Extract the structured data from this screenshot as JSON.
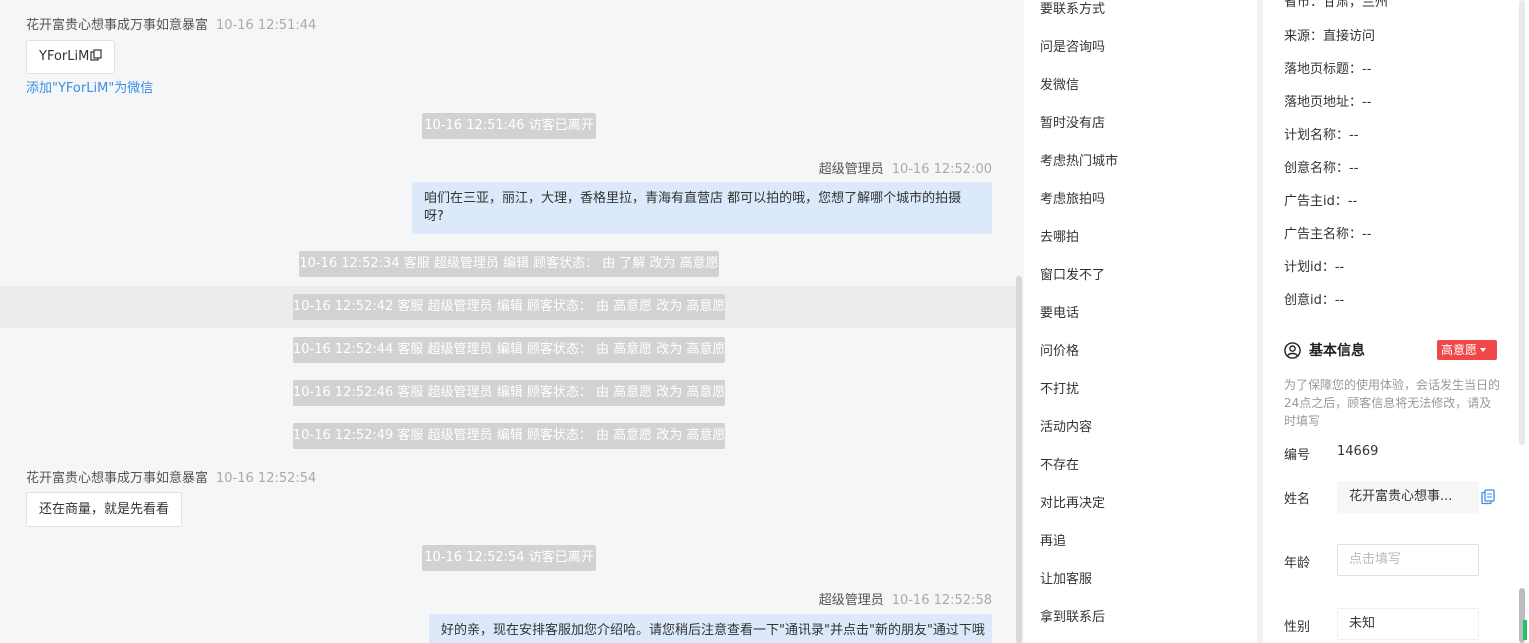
{
  "chat": {
    "messages": [
      {
        "sender": "花开富贵心想事成万事如意暴富",
        "time": "10-16 12:51:44",
        "bubble": "YForLiM",
        "add_wechat_link": "添加\"YForLiM\"为微信"
      },
      {
        "system": "10-16 12:51:46 访客已离开"
      },
      {
        "sender": "超级管理员",
        "time": "10-16 12:52:00",
        "text": "咱们在三亚，丽江，大理，香格里拉，青海有直营店 都可以拍的哦，您想了解哪个城市的拍摄呀?"
      },
      {
        "system": "10-16 12:52:34 客服 超级管理员 编辑 顾客状态： 由 了解 改为 高意愿"
      },
      {
        "system": "10-16 12:52:42 客服 超级管理员 编辑 顾客状态： 由 高意愿 改为 高意愿"
      },
      {
        "system": "10-16 12:52:44 客服 超级管理员 编辑 顾客状态： 由 高意愿 改为 高意愿"
      },
      {
        "system": "10-16 12:52:46 客服 超级管理员 编辑 顾客状态： 由 高意愿 改为 高意愿"
      },
      {
        "system": "10-16 12:52:49 客服 超级管理员 编辑 顾客状态： 由 高意愿 改为 高意愿"
      },
      {
        "sender": "花开富贵心想事成万事如意暴富",
        "time": "10-16 12:52:54",
        "bubble": "还在商量，就是先看看"
      },
      {
        "system": "10-16 12:52:54 访客已离开"
      },
      {
        "sender": "超级管理员",
        "time": "10-16 12:52:58",
        "text": "好的亲，现在安排客服加您介绍哈。请您稍后注意查看一下\"通讯录\"并点击\"新的朋友\"通过下哦"
      }
    ]
  },
  "quick_replies": [
    "要联系方式",
    "问是咨询吗",
    "发微信",
    "暂时没有店",
    "考虑热门城市",
    "考虑旅拍吗",
    "去哪拍",
    "窗口发不了",
    "要电话",
    "问价格",
    "不打扰",
    "活动内容",
    "不存在",
    "对比再决定",
    "再追",
    "让加客服",
    "拿到联系后"
  ],
  "info": {
    "lines": [
      "省市：甘肃，兰州",
      "来源：直接访问",
      "落地页标题：--",
      "落地页地址：--",
      "计划名称：--",
      "创意名称：--",
      "广告主id：--",
      "广告主名称：--",
      "计划id：--",
      "创意id：--"
    ],
    "section_title": "基本信息",
    "section_icon": "user-circle-icon",
    "intent_badge": "高意愿",
    "notice": "为了保障您的使用体验，会话发生当日的24点之后，顾客信息将无法修改，请及时填写",
    "fields": {
      "number_label": "编号",
      "number_value": "14669",
      "name_label": "姓名",
      "name_value": "花开富贵心想事...",
      "age_label": "年龄",
      "age_placeholder": "点击填写",
      "gender_label": "性别",
      "gender_value": "未知"
    }
  },
  "colors": {
    "accent_blue": "#3a8ee6",
    "badge_red": "#f04848",
    "bubble_blue": "#dbe9fb",
    "system_gray": "#d2d2d2"
  }
}
